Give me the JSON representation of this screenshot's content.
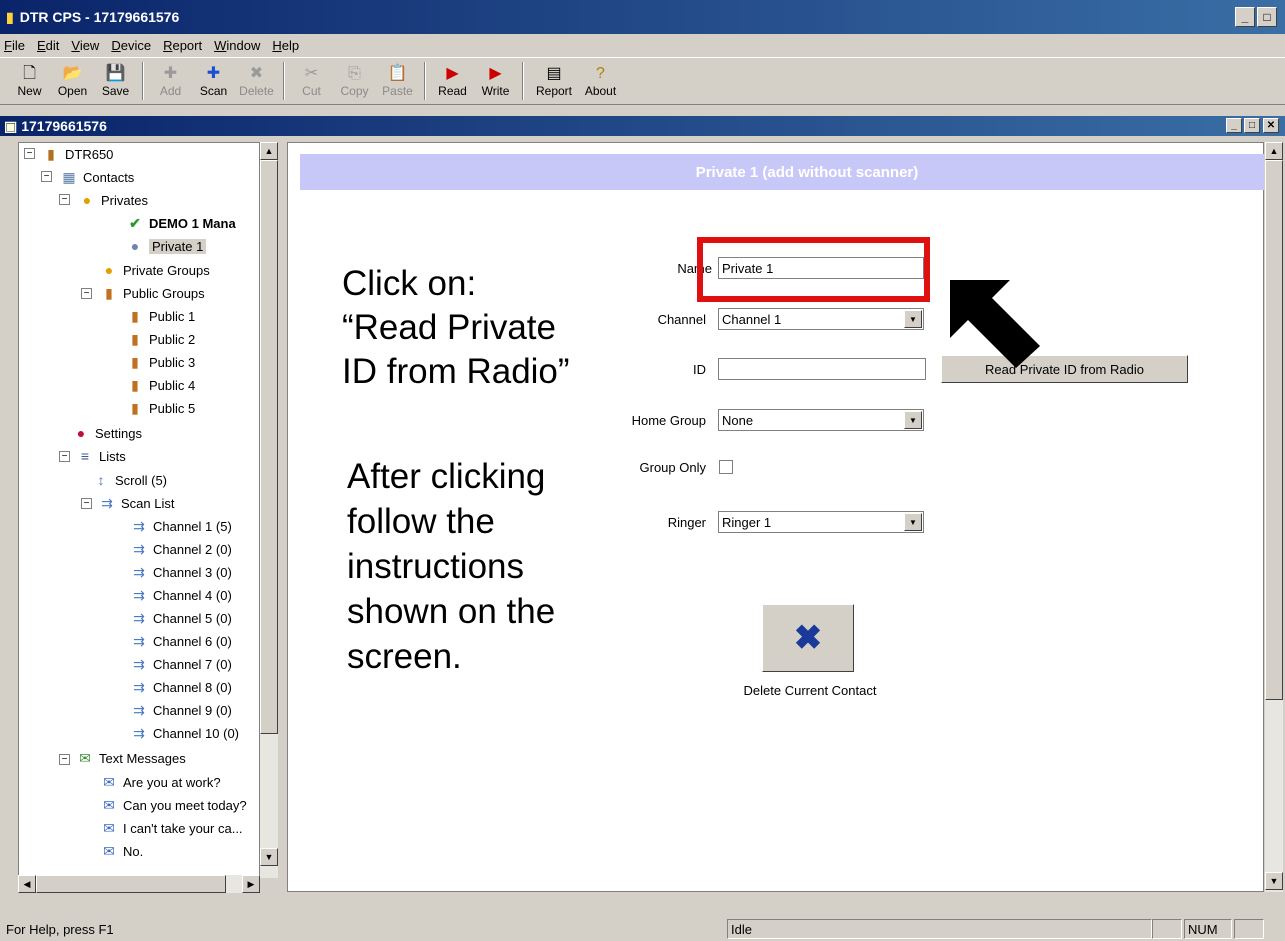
{
  "app": {
    "title": "DTR CPS - 17179661576"
  },
  "menu": [
    "File",
    "Edit",
    "View",
    "Device",
    "Report",
    "Window",
    "Help"
  ],
  "toolbar": {
    "new": "New",
    "open": "Open",
    "save": "Save",
    "add": "Add",
    "scan": "Scan",
    "delete": "Delete",
    "cut": "Cut",
    "copy": "Copy",
    "paste": "Paste",
    "read": "Read",
    "write": "Write",
    "report": "Report",
    "about": "About"
  },
  "child_window": {
    "title": "17179661576"
  },
  "tree": {
    "root": "DTR650",
    "contacts": "Contacts",
    "privates": "Privates",
    "demo": "DEMO 1 Mana",
    "private1": "Private 1",
    "private_groups": "Private Groups",
    "public_groups": "Public Groups",
    "publics": [
      "Public 1",
      "Public 2",
      "Public 3",
      "Public 4",
      "Public 5"
    ],
    "settings": "Settings",
    "lists": "Lists",
    "scroll": "Scroll (5)",
    "scan_list": "Scan List",
    "channels": [
      "Channel 1 (5)",
      "Channel 2 (0)",
      "Channel 3 (0)",
      "Channel 4 (0)",
      "Channel 5 (0)",
      "Channel 6 (0)",
      "Channel 7 (0)",
      "Channel 8 (0)",
      "Channel 9 (0)",
      "Channel 10 (0)"
    ],
    "text_messages": "Text Messages",
    "messages": [
      "Are you at work?",
      "Can you meet today?",
      "I can't take your ca...",
      "No."
    ]
  },
  "form": {
    "banner": "Private 1 (add without scanner)",
    "name_label": "Name",
    "name_value": "Private 1",
    "channel_label": "Channel",
    "channel_value": "Channel 1",
    "id_label": "ID",
    "id_value": "",
    "read_button": "Read Private ID from Radio",
    "home_group_label": "Home Group",
    "home_group_value": "None",
    "group_only_label": "Group Only",
    "group_only_checked": false,
    "ringer_label": "Ringer",
    "ringer_value": "Ringer 1",
    "delete_label": "Delete Current Contact"
  },
  "annotation": {
    "line1": "Click on:",
    "line2": "“Read Private",
    "line3": "ID from Radio”",
    "after1": "After clicking",
    "after2": "follow the",
    "after3": "instructions",
    "after4": "shown on the",
    "after5": "screen.",
    "highlight_color": "#e01010"
  },
  "status": {
    "help": "For Help, press F1",
    "state": "Idle",
    "num": "NUM"
  }
}
